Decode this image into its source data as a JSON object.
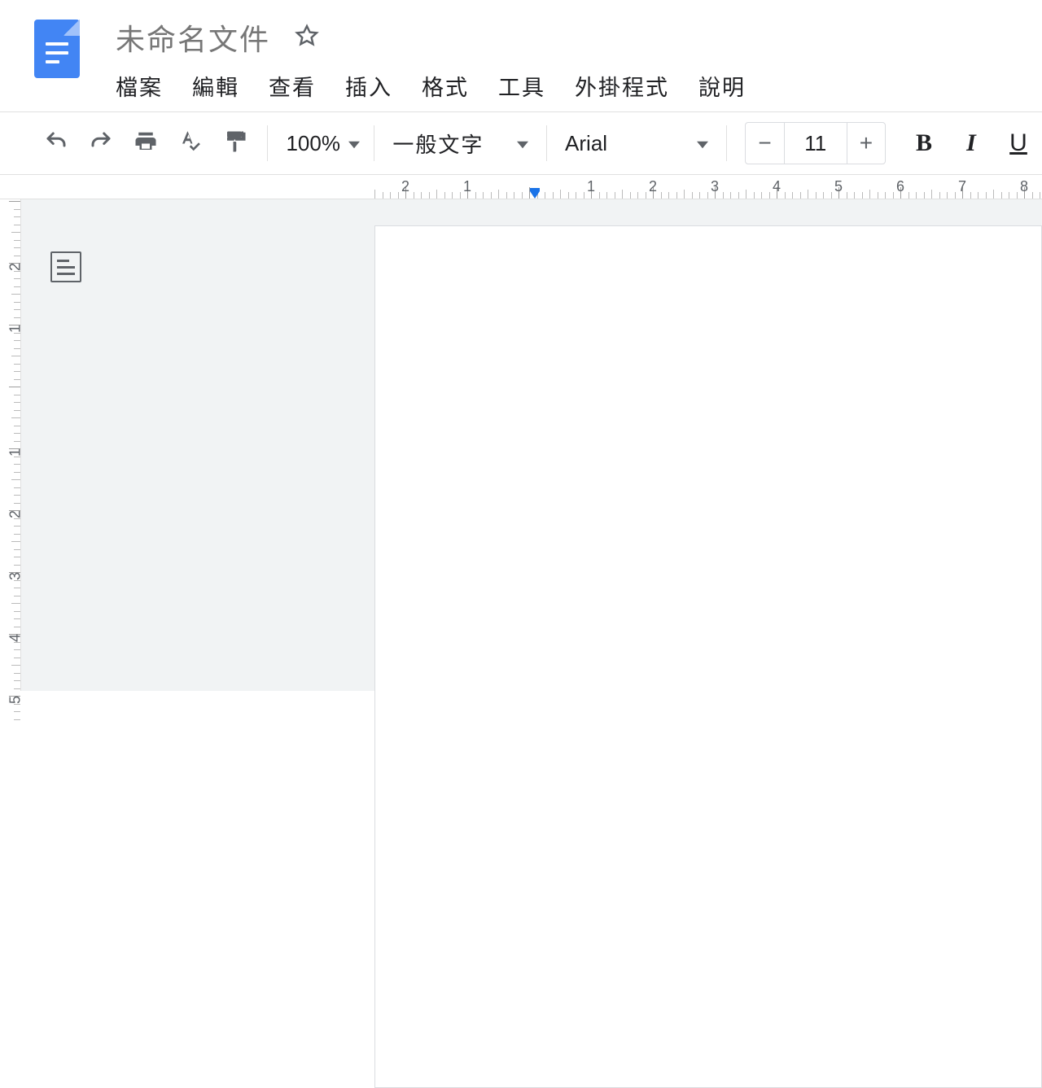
{
  "header": {
    "title": "未命名文件"
  },
  "menu": {
    "file": "檔案",
    "edit": "編輯",
    "view": "查看",
    "insert": "插入",
    "format": "格式",
    "tools": "工具",
    "addons": "外掛程式",
    "help": "說明"
  },
  "toolbar": {
    "zoom": "100%",
    "paragraph_style": "一般文字",
    "font": "Arial",
    "font_size": "11",
    "minus": "−",
    "plus": "+",
    "bold_glyph": "B",
    "italic_glyph": "I",
    "underline_glyph": "U"
  },
  "ruler": {
    "h_labels": [
      "2",
      "1",
      "1",
      "2",
      "3",
      "4",
      "5",
      "6",
      "7",
      "8"
    ],
    "v_labels": [
      "2",
      "1",
      "1",
      "2",
      "3",
      "4",
      "5"
    ]
  }
}
